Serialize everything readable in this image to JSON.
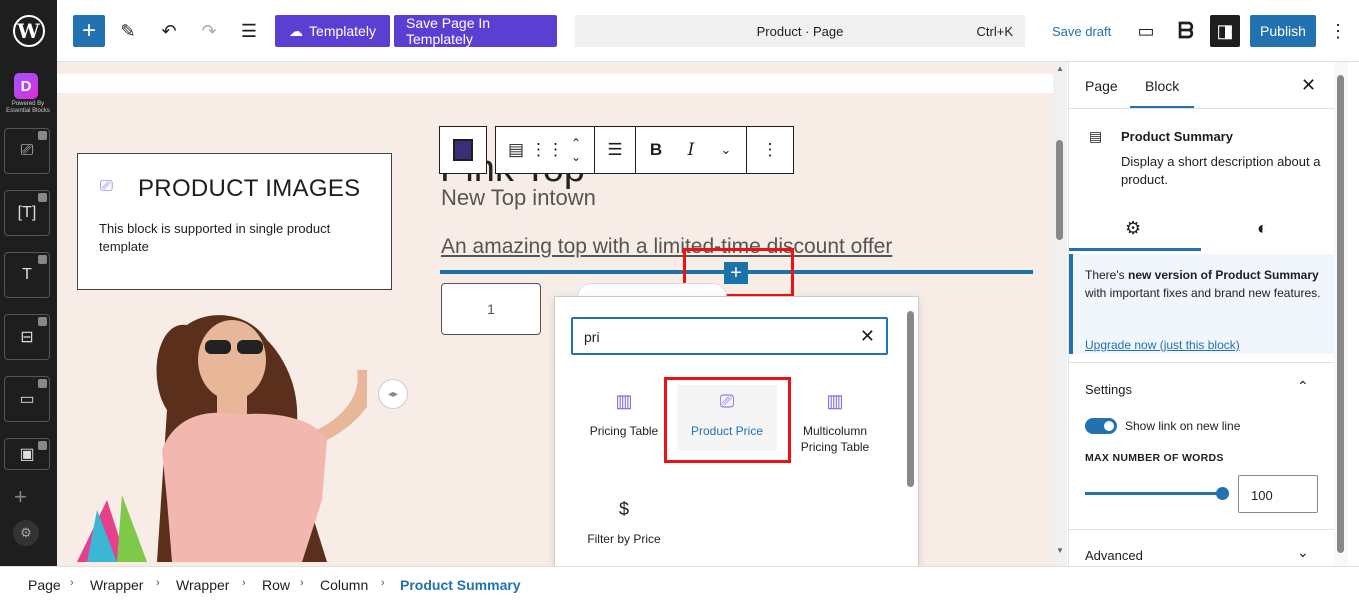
{
  "topbar": {
    "templately_label": "Templately",
    "save_templately_label": "Save Page In Templately",
    "command_title": "Product · Page",
    "command_shortcut": "Ctrl+K",
    "save_draft": "Save draft",
    "publish": "Publish"
  },
  "leftbar": {
    "caption": "Powered By Essential Blocks"
  },
  "canvas": {
    "product_images_title": "PRODUCT IMAGES",
    "product_images_text": "This block is supported in single product template",
    "product_title": "Pink Top",
    "subtitle": "New Top intown",
    "summary": "An amazing top with a limited-time discount offer",
    "quantity": "1"
  },
  "inserter": {
    "search_value": "pri",
    "blocks": [
      {
        "label": "Pricing Table",
        "icon": "pricing-table-icon"
      },
      {
        "label": "Product Price",
        "icon": "product-price-icon"
      },
      {
        "label": "Multicolumn Pricing Table",
        "icon": "multicolumn-pricing-icon"
      },
      {
        "label": "Filter by Price",
        "icon": "dollar-circle-icon"
      }
    ]
  },
  "sidebar": {
    "tab_page": "Page",
    "tab_block": "Block",
    "block_title": "Product Summary",
    "block_desc": "Display a short description about a product.",
    "notice_text_pre": "There's ",
    "notice_strong": "new version of Product Summary",
    "notice_text_post": " with important fixes and brand new features.",
    "upgrade_link": "Upgrade now (just this block)",
    "settings_heading": "Settings",
    "toggle_label": "Show link on new line",
    "max_words_label": "MAX NUMBER OF WORDS",
    "max_words_value": "100",
    "max_words_level": 1.0,
    "advanced_heading": "Advanced"
  },
  "breadcrumb": [
    "Page",
    "Wrapper",
    "Wrapper",
    "Row",
    "Column",
    "Product Summary"
  ],
  "colors": {
    "accent": "#2271b1",
    "purple": "#5b3fd3",
    "highlight": "#e11111"
  }
}
